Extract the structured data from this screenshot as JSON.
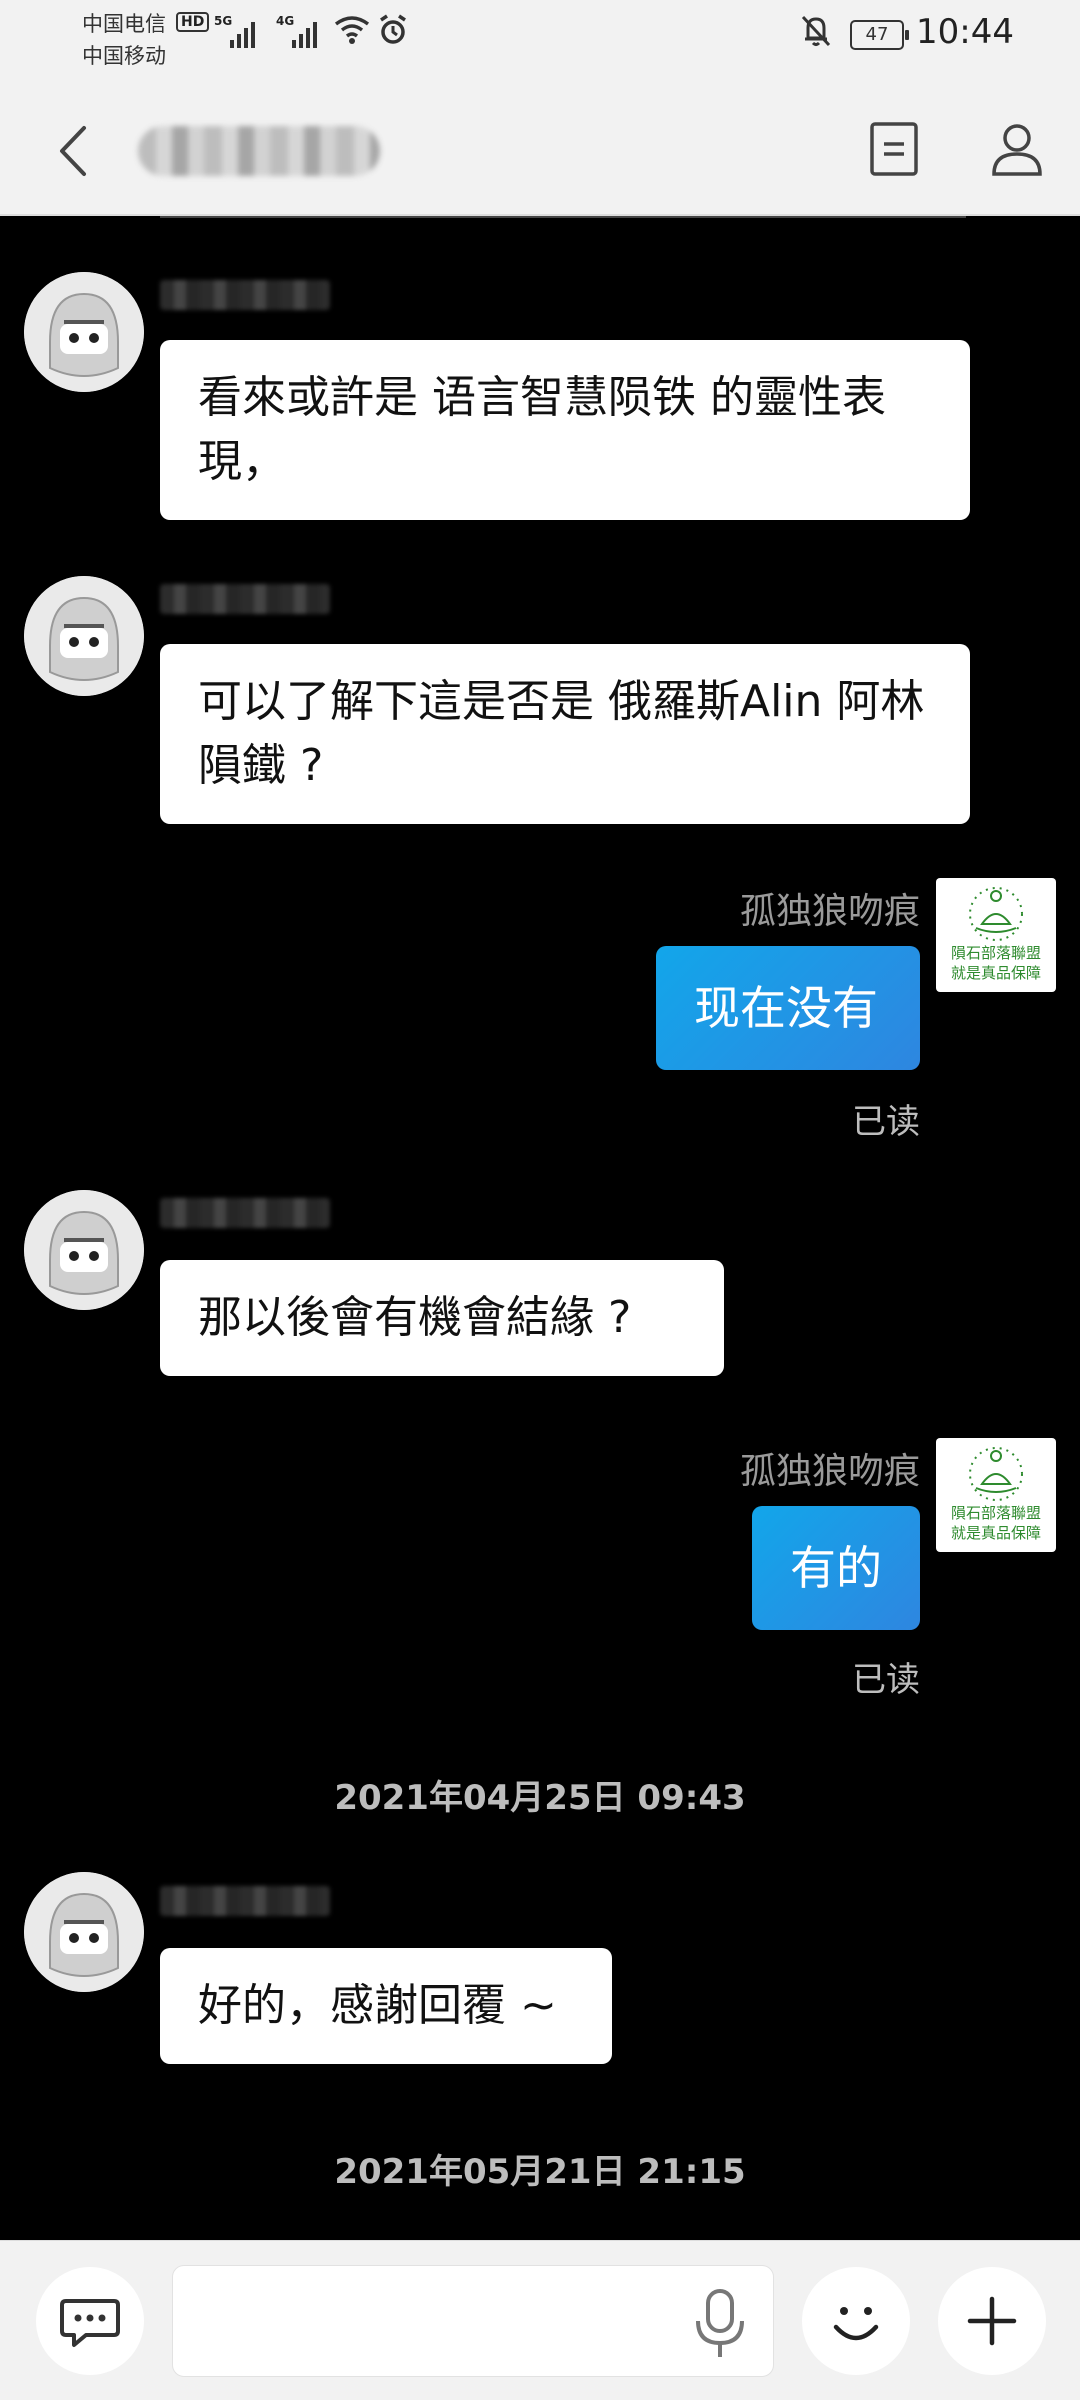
{
  "status_bar": {
    "carrier_1": "中国电信",
    "carrier_2": "中国移动",
    "hd_badge": "HD",
    "net_1": "5G",
    "net_2": "4G",
    "battery": "47",
    "time": "10:44"
  },
  "header": {
    "title": "",
    "icons": [
      "back-arrow-icon",
      "notes-icon",
      "profile-icon"
    ]
  },
  "messages": {
    "m1": {
      "sender": "",
      "text": "看來或許是 语言智慧陨铁 的靈性表現，"
    },
    "m2": {
      "sender": "",
      "text": "可以了解下這是否是 俄羅斯Alin 阿林隕鐵 ?"
    },
    "m3": {
      "sender": "孤独狼吻痕",
      "text": "现在没有",
      "status": "已读"
    },
    "m4": {
      "sender": "",
      "text": "那以後會有機會結緣 ?"
    },
    "m5": {
      "sender": "孤独狼吻痕",
      "text": "有的",
      "status": "已读"
    },
    "ts1": "2021年04月25日 09:43",
    "m6": {
      "sender": "",
      "text": "好的，感謝回覆 ~"
    },
    "ts2": "2021年05月21日 21:15"
  },
  "my_avatar": {
    "line1": "隕石部落聯盟",
    "line2": "就是真品保障"
  },
  "input_bar": {
    "placeholder": "",
    "icons": [
      "chat-bubble-icon",
      "microphone-icon",
      "emoji-icon",
      "plus-icon"
    ]
  },
  "colors": {
    "chat_background": "#000000",
    "outgoing_bubble": "#1a9be8",
    "incoming_bubble": "#ffffff",
    "header_background": "#f2f2f2"
  }
}
